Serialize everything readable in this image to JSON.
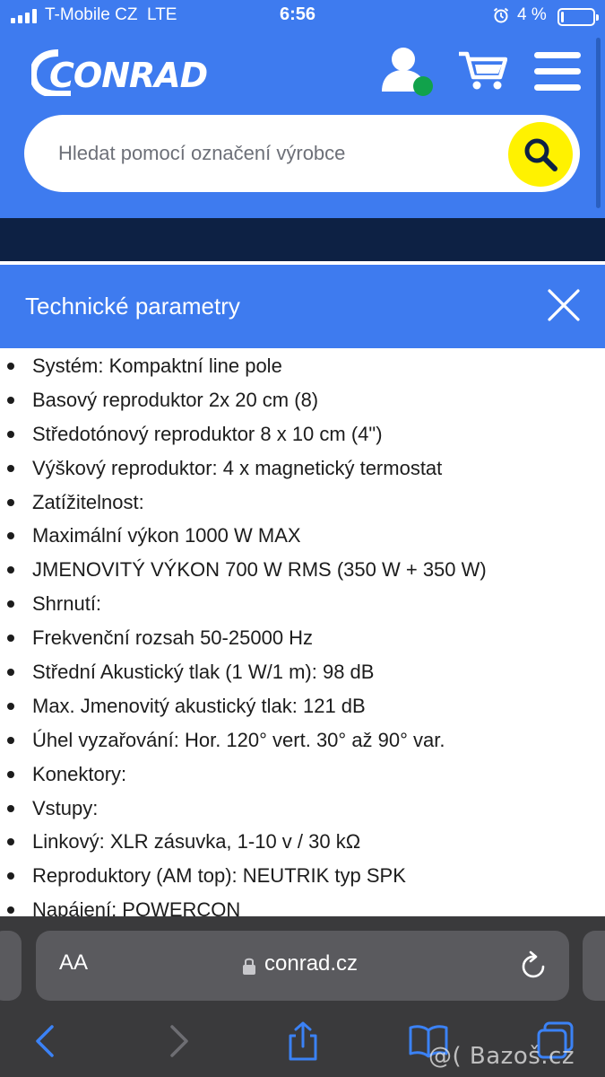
{
  "status_bar": {
    "carrier": "T-Mobile CZ",
    "network": "LTE",
    "time": "6:56",
    "battery_percent": "4 %",
    "icons": [
      "signal-icon",
      "alarm-icon",
      "battery-icon"
    ]
  },
  "header": {
    "logo_text": "CONRAD",
    "icons": [
      "user-icon",
      "online-status-dot",
      "cart-icon",
      "menu-icon"
    ],
    "accent_color": "#3e7bef",
    "online_dot_color": "#11a24b"
  },
  "search": {
    "placeholder": "Hledat pomocí označení výrobce",
    "button_icon": "search-icon",
    "button_color": "#fff200"
  },
  "modal": {
    "title": "Technické parametry",
    "close_icon": "close-icon",
    "items": [
      "Systém: Kompaktní line pole",
      "Basový reproduktor 2x 20 cm (8)",
      "Středotónový reproduktor 8 x 10 cm (4\")",
      "Výškový reproduktor: 4 x magnetický termostat",
      "Zatížitelnost:",
      "Maximální výkon 1000 W MAX",
      "JMENOVITÝ VÝKON 700 W RMS (350 W + 350 W)",
      "Shrnutí:",
      "Frekvenční rozsah 50-25000 Hz",
      "Střední Akustický tlak (1 W/1 m): 98 dB",
      "Max. Jmenovitý akustický tlak: 121 dB",
      "Úhel vyzařování: Hor. 120° vert. 30° až 90° var.",
      "Konektory:",
      "Vstupy:",
      "Linkový: XLR zásuvka, 1-10 v / 30 kΩ",
      "Reproduktory (AM top): NEUTRIK typ SPK",
      "Napájení: POWERCON"
    ]
  },
  "browser": {
    "aa_label": "AA",
    "url": "conrad.cz",
    "toolbar_icons": [
      "back-icon",
      "forward-icon",
      "share-icon",
      "bookmarks-icon",
      "tabs-icon"
    ],
    "watermark": "@( Bazoš.cz"
  }
}
